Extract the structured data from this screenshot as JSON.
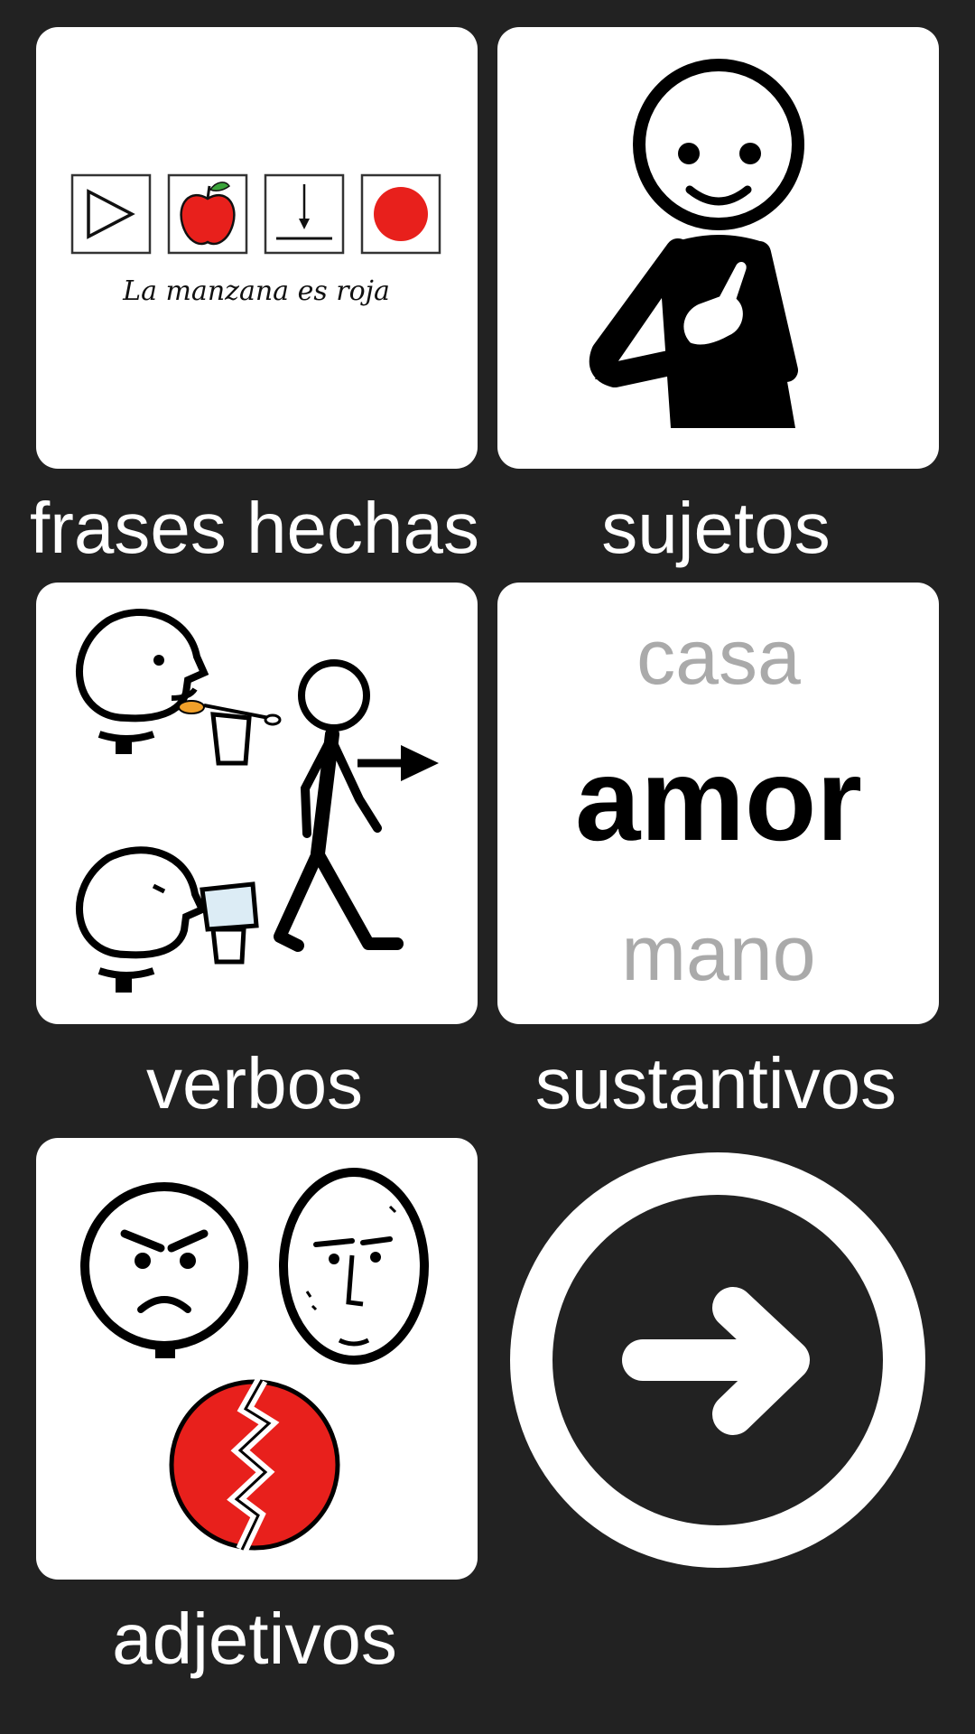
{
  "grid": {
    "items": [
      {
        "label": "frases hechas",
        "icon": "sentence-strip-icon",
        "example_sentence": "La manzana es roja"
      },
      {
        "label": "sujetos",
        "icon": "person-pointing-self-icon"
      },
      {
        "label": "verbos",
        "icon": "actions-icon"
      },
      {
        "label": "sustantivos",
        "icon": "nouns-words-icon",
        "words": [
          "casa",
          "amor",
          "mano"
        ]
      },
      {
        "label": "adjetivos",
        "icon": "emotions-icon"
      }
    ],
    "next": {
      "icon": "arrow-right-circle-icon"
    }
  },
  "colors": {
    "background": "#222222",
    "tile": "#ffffff",
    "caption": "#ffffff",
    "accent_red": "#e8201c"
  }
}
